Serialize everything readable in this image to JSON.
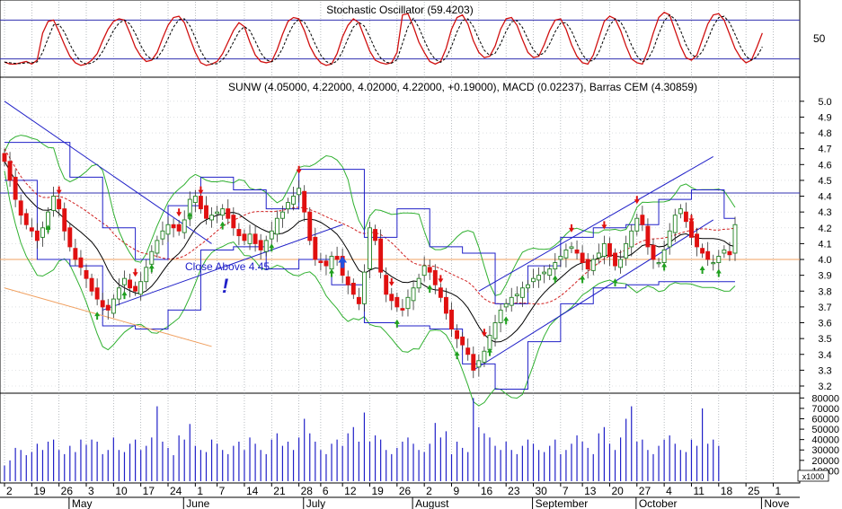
{
  "oscillator": {
    "title": "Stochastic Oscillator (59.4203)",
    "level_label": "50",
    "ylim": [
      0,
      100
    ],
    "upper_band": 80,
    "lower_band": 20
  },
  "price": {
    "title": "SUNW (4.05000, 4.22000, 4.02000, 4.22000, +0.19000), MACD (0.02237), Barras CEM (4.30859)",
    "annotation": "Close Above 4.45",
    "alert_glyph": "!",
    "ylim": [
      3.2,
      5.05
    ],
    "ticks": [
      "5.0",
      "4.9",
      "4.8",
      "4.7",
      "4.6",
      "4.5",
      "4.4",
      "4.3",
      "4.2",
      "4.1",
      "4.0",
      "3.9",
      "3.8",
      "3.7",
      "3.6",
      "3.5",
      "3.4",
      "3.3",
      "3.2"
    ],
    "resistance_level": 4.42,
    "reference_level": 4.0
  },
  "volume": {
    "ticks": [
      "80000",
      "70000",
      "60000",
      "50000",
      "40000",
      "30000",
      "20000",
      "10000"
    ],
    "multiplier_label": "x1000",
    "ylim": [
      0,
      82000
    ]
  },
  "xaxis": {
    "day_labels": [
      {
        "t": "2",
        "i": 0
      },
      {
        "t": "19",
        "i": 5
      },
      {
        "t": "26",
        "i": 10
      },
      {
        "t": "3",
        "i": 15
      },
      {
        "t": "10",
        "i": 20
      },
      {
        "t": "17",
        "i": 25
      },
      {
        "t": "24",
        "i": 30
      },
      {
        "t": "1",
        "i": 35
      },
      {
        "t": "7",
        "i": 39
      },
      {
        "t": "14",
        "i": 44
      },
      {
        "t": "21",
        "i": 49
      },
      {
        "t": "28",
        "i": 54
      },
      {
        "t": "6",
        "i": 58
      },
      {
        "t": "12",
        "i": 62
      },
      {
        "t": "19",
        "i": 67
      },
      {
        "t": "26",
        "i": 72
      },
      {
        "t": "2",
        "i": 77
      },
      {
        "t": "9",
        "i": 82
      },
      {
        "t": "16",
        "i": 87
      },
      {
        "t": "23",
        "i": 92
      },
      {
        "t": "30",
        "i": 97
      },
      {
        "t": "7",
        "i": 102
      },
      {
        "t": "13",
        "i": 106
      },
      {
        "t": "20",
        "i": 111
      },
      {
        "t": "27",
        "i": 116
      },
      {
        "t": "4",
        "i": 121
      },
      {
        "t": "11",
        "i": 126
      },
      {
        "t": "18",
        "i": 131
      },
      {
        "t": "25",
        "i": 136
      },
      {
        "t": "1",
        "i": 141
      }
    ],
    "month_labels": [
      {
        "t": "May",
        "i": 13
      },
      {
        "t": "June",
        "i": 34
      },
      {
        "t": "July",
        "i": 56
      },
      {
        "t": "August",
        "i": 76
      },
      {
        "t": "September",
        "i": 98
      },
      {
        "t": "October",
        "i": 117
      },
      {
        "t": "Nove",
        "i": 140
      }
    ]
  },
  "chart_data": {
    "type": "candlestick",
    "symbol": "SUNW",
    "last_bar": {
      "open": 4.05,
      "high": 4.22,
      "low": 4.02,
      "close": 4.22,
      "change": 0.19
    },
    "macd": 0.02237,
    "barras_cem": 4.30859,
    "stochastic": 59.4203,
    "closes": [
      4.62,
      4.5,
      4.38,
      4.28,
      4.22,
      4.18,
      4.12,
      4.2,
      4.3,
      4.4,
      4.32,
      4.18,
      4.08,
      4.0,
      3.95,
      3.88,
      3.8,
      3.75,
      3.7,
      3.68,
      3.75,
      3.82,
      3.88,
      3.82,
      3.8,
      3.86,
      3.95,
      4.05,
      4.12,
      4.18,
      4.22,
      4.2,
      4.18,
      4.25,
      4.38,
      4.4,
      4.32,
      4.26,
      4.28,
      4.3,
      4.32,
      4.26,
      4.2,
      4.15,
      4.12,
      4.16,
      4.1,
      4.06,
      4.12,
      4.18,
      4.26,
      4.3,
      4.36,
      4.4,
      4.45,
      4.3,
      4.12,
      4.0,
      3.98,
      3.96,
      4.02,
      4.0,
      3.9,
      3.84,
      3.78,
      3.72,
      3.92,
      4.2,
      4.12,
      3.92,
      3.78,
      3.74,
      3.7,
      3.68,
      3.76,
      3.82,
      3.88,
      3.96,
      3.92,
      3.84,
      3.76,
      3.66,
      3.56,
      3.5,
      3.46,
      3.4,
      3.3,
      3.36,
      3.42,
      3.52,
      3.6,
      3.68,
      3.72,
      3.76,
      3.78,
      3.82,
      3.84,
      3.88,
      3.9,
      3.92,
      3.94,
      3.98,
      4.02,
      4.06,
      4.08,
      4.04,
      3.98,
      3.94,
      4.0,
      4.04,
      4.1,
      4.02,
      3.96,
      4.0,
      4.1,
      4.18,
      4.26,
      4.22,
      4.08,
      4.0,
      3.98,
      4.06,
      4.18,
      4.28,
      4.32,
      4.24,
      4.14,
      4.08,
      4.04,
      4.0,
      3.98,
      4.02,
      4.06,
      4.03,
      4.22
    ],
    "volume": [
      15000,
      20000,
      32000,
      30000,
      25000,
      28000,
      36000,
      30000,
      38000,
      40000,
      30000,
      26000,
      34000,
      28000,
      40000,
      35000,
      40000,
      38000,
      26000,
      30000,
      42000,
      30000,
      28000,
      36000,
      40000,
      30000,
      34000,
      42000,
      72000,
      38000,
      32000,
      25000,
      44000,
      40000,
      55000,
      34000,
      30000,
      28000,
      40000,
      36000,
      30000,
      26000,
      34000,
      38000,
      30000,
      42000,
      36000,
      30000,
      26000,
      40000,
      46000,
      34000,
      38000,
      30000,
      42000,
      60000,
      46000,
      38000,
      30000,
      26000,
      36000,
      40000,
      34000,
      46000,
      52000,
      38000,
      66000,
      38000,
      44000,
      40000,
      30000,
      26000,
      32000,
      38000,
      42000,
      36000,
      30000,
      28000,
      36000,
      56000,
      42000,
      48000,
      26000,
      38000,
      32000,
      28000,
      80000,
      52000,
      46000,
      42000,
      34000,
      30000,
      38000,
      30000,
      26000,
      34000,
      40000,
      36000,
      30000,
      28000,
      34000,
      40000,
      26000,
      30000,
      36000,
      44000,
      38000,
      32000,
      26000,
      46000,
      52000,
      36000,
      30000,
      42000,
      60000,
      72000,
      38000,
      40000,
      30000,
      26000,
      34000,
      40000,
      44000,
      36000,
      30000,
      28000,
      40000,
      34000,
      70000,
      36000,
      40000,
      34000
    ],
    "stochastic_k": [
      15,
      12,
      12,
      14,
      16,
      12,
      18,
      60,
      78,
      80,
      62,
      42,
      24,
      14,
      10,
      12,
      18,
      28,
      48,
      66,
      78,
      82,
      80,
      60,
      38,
      24,
      16,
      18,
      30,
      52,
      72,
      84,
      86,
      76,
      52,
      30,
      14,
      10,
      12,
      16,
      28,
      46,
      64,
      76,
      70,
      46,
      26,
      16,
      14,
      16,
      34,
      58,
      78,
      84,
      82,
      64,
      40,
      24,
      14,
      10,
      12,
      28,
      54,
      72,
      82,
      76,
      54,
      32,
      18,
      14,
      12,
      14,
      30,
      88,
      90,
      70,
      46,
      30,
      16,
      12,
      16,
      36,
      66,
      84,
      88,
      74,
      48,
      30,
      22,
      24,
      40,
      66,
      82,
      84,
      72,
      50,
      30,
      22,
      24,
      42,
      64,
      80,
      82,
      66,
      42,
      24,
      14,
      12,
      26,
      52,
      78,
      86,
      82,
      64,
      40,
      20,
      14,
      12,
      32,
      60,
      84,
      92,
      88,
      64,
      40,
      22,
      18,
      26,
      50,
      74,
      88,
      90,
      80,
      58,
      36,
      22,
      14,
      18,
      38,
      60
    ]
  }
}
